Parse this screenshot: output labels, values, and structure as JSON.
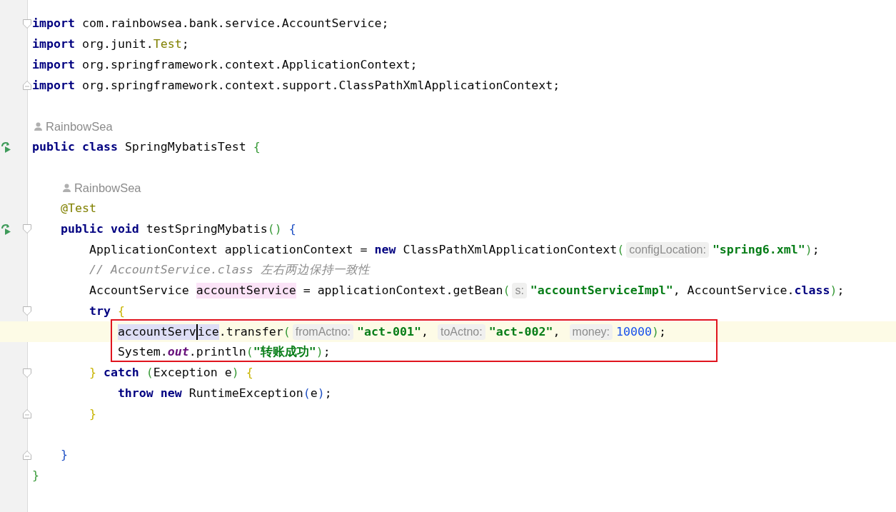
{
  "editor": {
    "lines": [
      {
        "kind": "code",
        "run": false,
        "fold_start": true,
        "fold_end": false,
        "current": false,
        "tokens": [
          {
            "kind": "keyword",
            "text": "import"
          },
          {
            "kind": "plain",
            "text": " com.rainbowsea.bank.service.AccountService;"
          }
        ]
      },
      {
        "kind": "code",
        "run": false,
        "fold_start": false,
        "fold_end": false,
        "current": false,
        "tokens": [
          {
            "kind": "keyword",
            "text": "import"
          },
          {
            "kind": "plain",
            "text": " org.junit."
          },
          {
            "kind": "annotation",
            "text": "Test"
          },
          {
            "kind": "plain",
            "text": ";"
          }
        ]
      },
      {
        "kind": "code",
        "run": false,
        "fold_start": false,
        "fold_end": false,
        "current": false,
        "tokens": [
          {
            "kind": "keyword",
            "text": "import"
          },
          {
            "kind": "plain",
            "text": " org.springframework.context.ApplicationContext;"
          }
        ]
      },
      {
        "kind": "code",
        "run": false,
        "fold_start": false,
        "fold_end": true,
        "current": false,
        "tokens": [
          {
            "kind": "keyword",
            "text": "import"
          },
          {
            "kind": "plain",
            "text": " org.springframework.context.support.ClassPathXmlApplicationContext;"
          }
        ]
      },
      {
        "kind": "blank",
        "run": false,
        "fold_start": false,
        "fold_end": false,
        "current": false
      },
      {
        "kind": "author",
        "run": false,
        "fold_start": false,
        "fold_end": false,
        "current": false,
        "text": "RainbowSea"
      },
      {
        "kind": "code",
        "run": true,
        "fold_start": false,
        "fold_end": false,
        "current": false,
        "tokens": [
          {
            "kind": "keyword",
            "text": "public class"
          },
          {
            "kind": "plain",
            "text": " SpringMybatisTest"
          },
          {
            "kind": "bracket",
            "text": " {",
            "color": "#389a38"
          }
        ],
        "children": [
          {
            "kind": "blank",
            "run": false,
            "fold_start": false,
            "fold_end": false,
            "current": false
          },
          {
            "kind": "author",
            "run": false,
            "fold_start": false,
            "fold_end": false,
            "current": false,
            "text": "RainbowSea"
          },
          {
            "kind": "code",
            "run": false,
            "fold_start": false,
            "fold_end": false,
            "current": false,
            "tokens": [
              {
                "kind": "annotation",
                "text": "@Test"
              }
            ]
          },
          {
            "kind": "code",
            "run": true,
            "fold_start": true,
            "fold_end": false,
            "current": false,
            "tokens": [
              {
                "kind": "keyword",
                "text": "public void"
              },
              {
                "kind": "plain",
                "text": " testSpringMybatis"
              },
              {
                "kind": "bracket",
                "text": "()",
                "color": "#389a38"
              },
              {
                "kind": "bracket",
                "text": " {",
                "color": "#1d4fc4"
              }
            ],
            "children": [
              {
                "kind": "code",
                "run": false,
                "fold_start": false,
                "fold_end": false,
                "current": false,
                "tokens": [
                  {
                    "kind": "plain",
                    "text": "ApplicationContext applicationContext = "
                  },
                  {
                    "kind": "keyword",
                    "text": "new"
                  },
                  {
                    "kind": "plain",
                    "text": " ClassPathXmlApplicationContext"
                  },
                  {
                    "kind": "bracket",
                    "text": "(",
                    "color": "#389a38"
                  },
                  {
                    "kind": "hint",
                    "text": "configLocation:"
                  },
                  {
                    "kind": "string",
                    "text": "\"spring6.xml\""
                  },
                  {
                    "kind": "bracket",
                    "text": ")",
                    "color": "#389a38"
                  },
                  {
                    "kind": "plain",
                    "text": ";"
                  }
                ]
              },
              {
                "kind": "code",
                "run": false,
                "fold_start": false,
                "fold_end": false,
                "current": false,
                "tokens": [
                  {
                    "kind": "comment",
                    "text": "// AccountService.class 左右两边保持一致性"
                  }
                ]
              },
              {
                "kind": "code",
                "run": false,
                "fold_start": false,
                "fold_end": false,
                "current": false,
                "tokens": [
                  {
                    "kind": "plain",
                    "text": "AccountService "
                  },
                  {
                    "kind": "write-usage",
                    "text": "accountService"
                  },
                  {
                    "kind": "plain",
                    "text": " = applicationContext.getBean"
                  },
                  {
                    "kind": "bracket",
                    "text": "(",
                    "color": "#389a38"
                  },
                  {
                    "kind": "hint",
                    "text": "s:"
                  },
                  {
                    "kind": "string",
                    "text": "\"accountServiceImpl\""
                  },
                  {
                    "kind": "plain",
                    "text": ", AccountService."
                  },
                  {
                    "kind": "keyword",
                    "text": "class"
                  },
                  {
                    "kind": "bracket",
                    "text": ")",
                    "color": "#389a38"
                  },
                  {
                    "kind": "plain",
                    "text": ";"
                  }
                ]
              },
              {
                "kind": "code",
                "run": false,
                "fold_start": true,
                "fold_end": false,
                "current": false,
                "tokens": [
                  {
                    "kind": "keyword",
                    "text": "try"
                  },
                  {
                    "kind": "bracket",
                    "text": " {",
                    "color": "#c8b400"
                  }
                ],
                "children": [
                  {
                    "kind": "frame",
                    "children": [
                      {
                        "kind": "code",
                        "run": false,
                        "fold_start": false,
                        "fold_end": false,
                        "current": true,
                        "tokens": [
                          {
                            "kind": "read-usage",
                            "text": "accountServ"
                          },
                          {
                            "kind": "caret"
                          },
                          {
                            "kind": "read-usage",
                            "text": "ice"
                          },
                          {
                            "kind": "plain",
                            "text": ".transfer"
                          },
                          {
                            "kind": "bracket",
                            "text": "(",
                            "color": "#389a38"
                          },
                          {
                            "kind": "hint",
                            "text": "fromActno:"
                          },
                          {
                            "kind": "string",
                            "text": "\"act-001\""
                          },
                          {
                            "kind": "plain",
                            "text": ", "
                          },
                          {
                            "kind": "hint",
                            "text": "toActno:"
                          },
                          {
                            "kind": "string",
                            "text": "\"act-002\""
                          },
                          {
                            "kind": "plain",
                            "text": ", "
                          },
                          {
                            "kind": "hint",
                            "text": "money:"
                          },
                          {
                            "kind": "number",
                            "text": "10000"
                          },
                          {
                            "kind": "bracket",
                            "text": ")",
                            "color": "#389a38"
                          },
                          {
                            "kind": "plain",
                            "text": ";"
                          }
                        ]
                      },
                      {
                        "kind": "code",
                        "run": false,
                        "fold_start": false,
                        "fold_end": false,
                        "current": false,
                        "tokens": [
                          {
                            "kind": "plain",
                            "text": "System."
                          },
                          {
                            "kind": "static",
                            "text": "out"
                          },
                          {
                            "kind": "plain",
                            "text": ".println"
                          },
                          {
                            "kind": "bracket",
                            "text": "(",
                            "color": "#389a38"
                          },
                          {
                            "kind": "string",
                            "text": "\"转账成功\""
                          },
                          {
                            "kind": "bracket",
                            "text": ")",
                            "color": "#389a38"
                          },
                          {
                            "kind": "plain",
                            "text": ";"
                          }
                        ]
                      }
                    ]
                  }
                ]
              },
              {
                "kind": "code",
                "run": false,
                "fold_start": true,
                "fold_end": false,
                "current": false,
                "tokens": [
                  {
                    "kind": "bracket",
                    "text": "}",
                    "color": "#c8b400"
                  },
                  {
                    "kind": "keyword",
                    "text": " catch"
                  },
                  {
                    "kind": "bracket",
                    "text": " (",
                    "color": "#389a38"
                  },
                  {
                    "kind": "plain",
                    "text": "Exception e"
                  },
                  {
                    "kind": "bracket",
                    "text": ")",
                    "color": "#389a38"
                  },
                  {
                    "kind": "bracket",
                    "text": " {",
                    "color": "#c8b400"
                  }
                ],
                "children": [
                  {
                    "kind": "code",
                    "run": false,
                    "fold_start": false,
                    "fold_end": false,
                    "current": false,
                    "tokens": [
                      {
                        "kind": "keyword",
                        "text": "throw new"
                      },
                      {
                        "kind": "plain",
                        "text": " RuntimeException"
                      },
                      {
                        "kind": "bracket",
                        "text": "(",
                        "color": "#1d4fc4"
                      },
                      {
                        "kind": "plain",
                        "text": "e"
                      },
                      {
                        "kind": "bracket",
                        "text": ")",
                        "color": "#1d4fc4"
                      },
                      {
                        "kind": "plain",
                        "text": ";"
                      }
                    ]
                  }
                ]
              },
              {
                "kind": "code",
                "run": false,
                "fold_start": false,
                "fold_end": true,
                "current": false,
                "tokens": [
                  {
                    "kind": "bracket",
                    "text": "}",
                    "color": "#c8b400"
                  }
                ]
              },
              {
                "kind": "blank",
                "run": false,
                "fold_start": false,
                "fold_end": false,
                "current": false
              }
            ]
          },
          {
            "kind": "code",
            "run": false,
            "fold_start": false,
            "fold_end": true,
            "current": false,
            "tokens": [
              {
                "kind": "bracket",
                "text": "}",
                "color": "#1d4fc4"
              }
            ]
          }
        ]
      },
      {
        "kind": "code",
        "run": false,
        "fold_start": false,
        "fold_end": false,
        "current": false,
        "tokens": [
          {
            "kind": "bracket",
            "text": "}",
            "color": "#389a38"
          }
        ]
      }
    ]
  }
}
